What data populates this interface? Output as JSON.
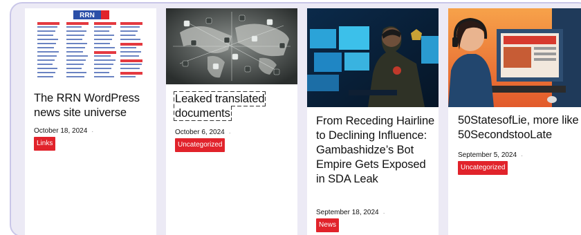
{
  "cards": [
    {
      "image_logo_text": "RRN",
      "title": "The RRN WordPress news site universe",
      "date": "October 18, 2024",
      "separator": "·",
      "category": "Links"
    },
    {
      "title": "Leaked translated documents",
      "date": "October 6, 2024",
      "separator": "·",
      "category": "Uncategorized"
    },
    {
      "title": "From Receding Hairline to Declining Influence: Gambashidze’s Bot Empire Gets Exposed in SDA Leak",
      "date": "September 18, 2024",
      "separator": "·",
      "category": "News"
    },
    {
      "title": "50StatesofLie, more like 50SecondstooLate",
      "date": "September 5, 2024",
      "separator": "·",
      "category": "Uncategorized"
    }
  ],
  "colors": {
    "category_bg": "#e1232b",
    "frame_bg": "#eceaf5",
    "frame_border": "#c9c6e8"
  }
}
